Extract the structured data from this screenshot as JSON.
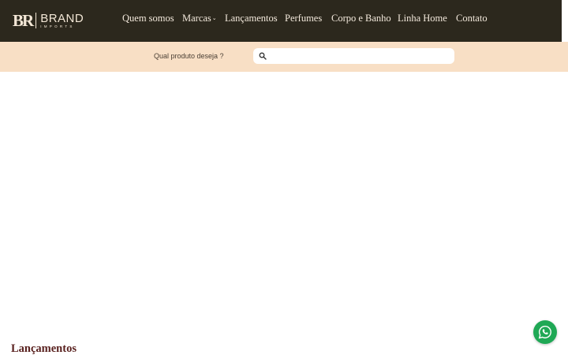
{
  "brand": {
    "mark": "BR",
    "name": "BRAND",
    "subtitle": "IMPORTS"
  },
  "nav": {
    "items": [
      {
        "label": "Quem somos"
      },
      {
        "label": "Marcas",
        "has_dropdown": true
      },
      {
        "label": "Lançamentos"
      },
      {
        "label": "Perfumes"
      },
      {
        "label": "Corpo e Banho"
      },
      {
        "label": "Linha Home"
      },
      {
        "label": "Contato"
      }
    ]
  },
  "search": {
    "label": "Qual produto deseja ?",
    "value": "",
    "placeholder": ""
  },
  "sections": {
    "launches_title": "Lançamentos"
  },
  "icons": {
    "search": "search-icon",
    "dropdown": "chevron-down-icon",
    "chat": "whatsapp-icon"
  },
  "colors": {
    "header_bg": "#2c281d",
    "header_text": "#f3e9dc",
    "search_bar_bg": "#f8dfc5",
    "section_title": "#5a2220",
    "whatsapp": "#1fa855"
  }
}
